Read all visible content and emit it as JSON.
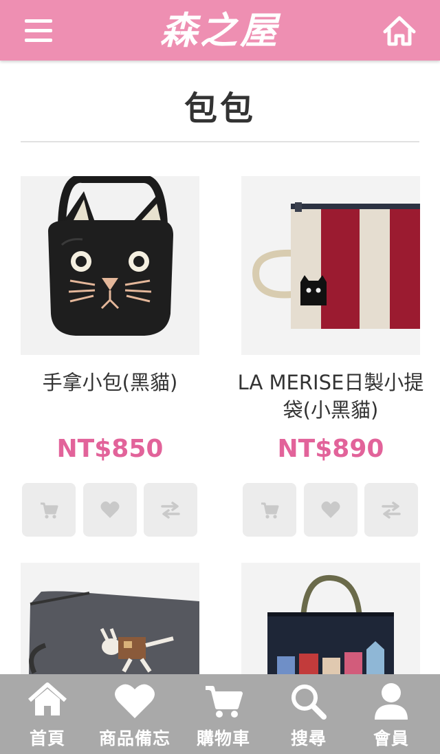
{
  "header": {
    "logo_text": "森之屋",
    "menu_icon": "hamburger-menu-icon",
    "home_icon": "home-outline-icon",
    "background_color": "#ee8fb2"
  },
  "page": {
    "title": "包包"
  },
  "products": [
    {
      "name": "手拿小包(黑貓)",
      "price": "NT$850"
    },
    {
      "name": "LA MERISE日製小提袋(小黑貓)",
      "price": "NT$890"
    },
    {
      "name": "",
      "price": ""
    },
    {
      "name": "",
      "price": ""
    }
  ],
  "product_actions": {
    "cart_icon": "cart-icon",
    "wishlist_icon": "heart-icon",
    "compare_icon": "compare-arrows-icon"
  },
  "bottom_nav": {
    "items": [
      {
        "label": "首頁",
        "icon": "home-icon"
      },
      {
        "label": "商品備忘",
        "icon": "heart-icon"
      },
      {
        "label": "購物車",
        "icon": "cart-icon"
      },
      {
        "label": "搜尋",
        "icon": "search-icon"
      },
      {
        "label": "會員",
        "icon": "user-icon"
      }
    ]
  },
  "colors": {
    "accent": "#ee8fb2",
    "price": "#e2639a",
    "nav_background": "#a9a9a9"
  }
}
